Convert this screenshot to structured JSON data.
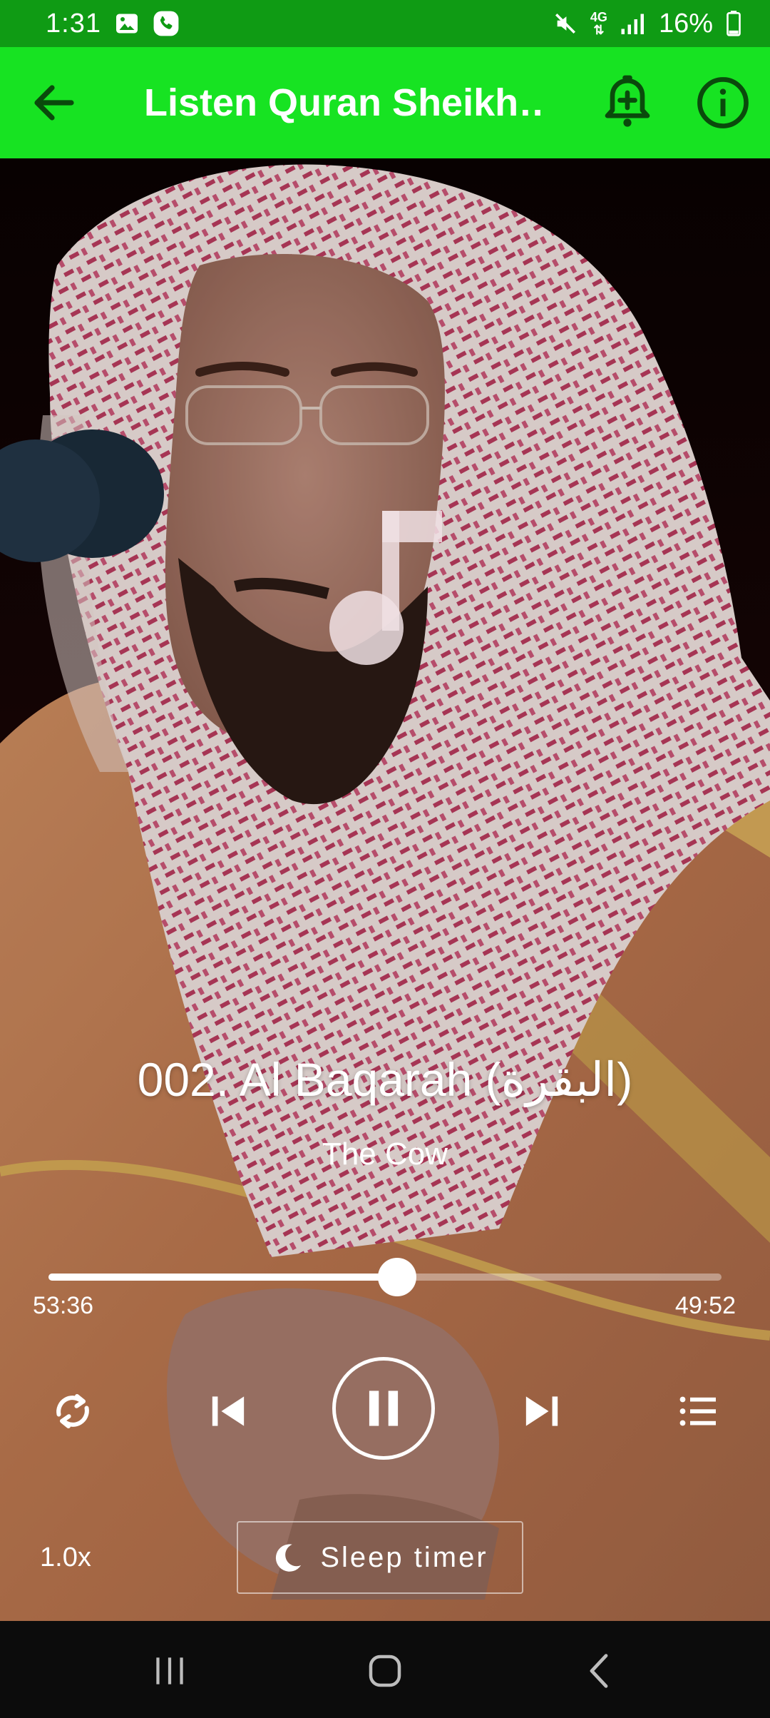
{
  "status_bar": {
    "time": "1:31",
    "network": "4G",
    "battery": "16%"
  },
  "app_bar": {
    "title": "Listen Quran Sheikh…",
    "accent": "#17e322"
  },
  "player": {
    "track_title": "002. Al Baqarah (البقرة)",
    "track_subtitle": "The Cow",
    "elapsed": "53:36",
    "remaining": "49:52",
    "progress_fraction": 0.518,
    "speed": "1.0x",
    "sleep_timer_label": "Sleep timer",
    "state": "playing"
  },
  "icons": [
    "back-arrow-icon",
    "add-alarm-icon",
    "info-icon",
    "music-note-icon",
    "repeat-icon",
    "skip-previous-icon",
    "pause-icon",
    "skip-next-icon",
    "queue-list-icon",
    "moon-icon",
    "recents-icon",
    "home-icon",
    "nav-back-icon"
  ]
}
